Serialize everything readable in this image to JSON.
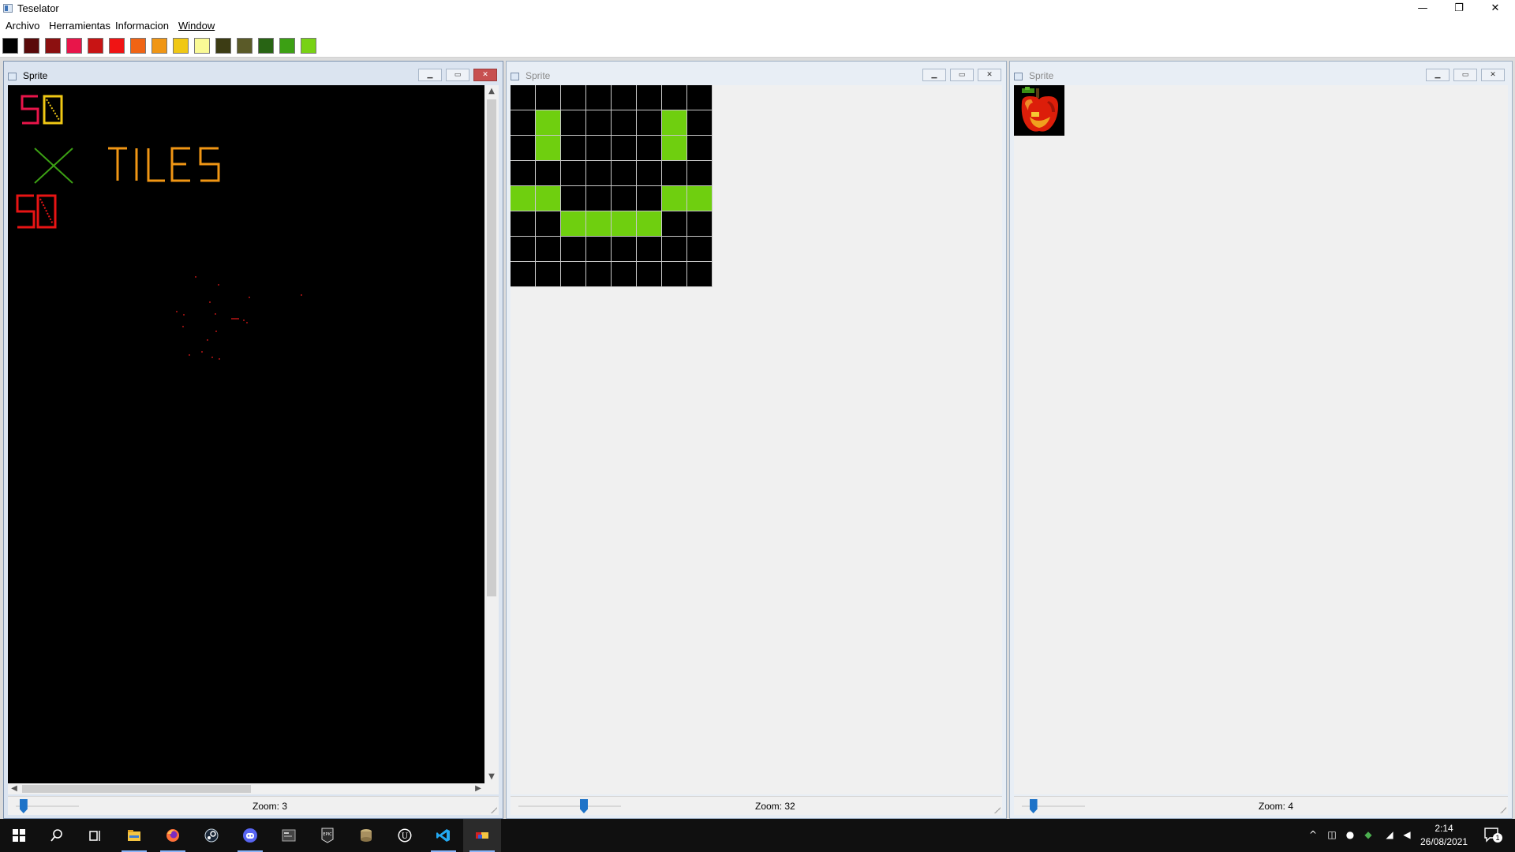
{
  "app": {
    "title": "Teselator"
  },
  "window_controls": {
    "minimize": "—",
    "restore": "❐",
    "close": "✕"
  },
  "menu": [
    "Archivo",
    "Herramientas",
    "Informacion",
    "Window"
  ],
  "palette": [
    "#000000",
    "#5a0a0a",
    "#8c1010",
    "#e8154a",
    "#c81414",
    "#f01414",
    "#f06414",
    "#f09614",
    "#f0c814",
    "#fafa96",
    "#3c3c14",
    "#5a5a28",
    "#286414",
    "#3ca014",
    "#78d214"
  ],
  "children": [
    {
      "title": "Sprite",
      "zoom": "Zoom: 3",
      "slider_value": 0.05,
      "canvas_text": {
        "line1": "58",
        "line2_x": "X",
        "line2_word": "TILES",
        "line3": "58"
      },
      "colors": {
        "line1_a": "#e8154a",
        "line1_b": "#f0c814",
        "x": "#3ca014",
        "word": "#f09614",
        "line3": "#e81414"
      }
    },
    {
      "title": "Sprite",
      "zoom": "Zoom: 32",
      "slider_value": 0.5,
      "tile_grid": [
        [
          0,
          0,
          0,
          0,
          0,
          0,
          0,
          0
        ],
        [
          0,
          1,
          0,
          0,
          0,
          0,
          1,
          0
        ],
        [
          0,
          1,
          0,
          0,
          0,
          0,
          1,
          0
        ],
        [
          0,
          0,
          0,
          0,
          0,
          0,
          0,
          0
        ],
        [
          1,
          1,
          0,
          0,
          0,
          0,
          1,
          1
        ],
        [
          0,
          0,
          1,
          1,
          1,
          1,
          0,
          0
        ],
        [
          0,
          0,
          0,
          0,
          0,
          0,
          0,
          0
        ],
        [
          0,
          0,
          0,
          0,
          0,
          0,
          0,
          0
        ]
      ],
      "fill_color": "#6fcf0f"
    },
    {
      "title": "Sprite",
      "zoom": "Zoom: 4",
      "slider_value": 0.1,
      "sprite": "apple"
    }
  ],
  "taskbar": {
    "apps": [
      "windows-start",
      "search",
      "task-view",
      "file-explorer",
      "firefox",
      "steam",
      "discord",
      "terminal-app",
      "epic-games",
      "database-app",
      "unreal-engine",
      "vscode",
      "teselator"
    ],
    "tray": [
      "chevron-up",
      "camera",
      "microphone",
      "shield",
      "network",
      "volume",
      "notifications"
    ],
    "time": "2:14",
    "date": "26/08/2021",
    "notification_count": "1"
  }
}
